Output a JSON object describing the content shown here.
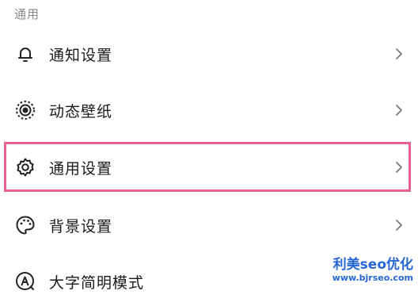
{
  "section": {
    "title": "通用"
  },
  "items": [
    {
      "label": "通知设置",
      "icon": "bell-icon"
    },
    {
      "label": "动态壁纸",
      "icon": "live-wallpaper-icon"
    },
    {
      "label": "通用设置",
      "icon": "gear-icon",
      "highlighted": true
    },
    {
      "label": "背景设置",
      "icon": "palette-icon"
    },
    {
      "label": "大字简明模式",
      "icon": "large-text-icon"
    }
  ],
  "watermark": {
    "main": "利美seo优化",
    "sub": "www.bjrseo.com"
  },
  "colors": {
    "highlight": "#e8638f",
    "watermark": "#2566d4",
    "section_label": "#8a8a8a"
  }
}
